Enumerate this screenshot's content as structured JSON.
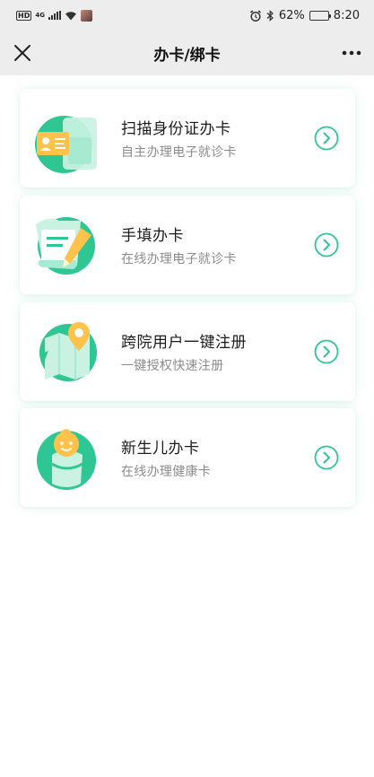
{
  "statusbar": {
    "hd": "HD",
    "network": "4G",
    "battery": "62%",
    "time": "8:20",
    "icons": [
      "alarm-icon",
      "bluetooth-icon",
      "wifi-icon",
      "signal-icon",
      "battery-icon"
    ]
  },
  "navbar": {
    "title": "办卡/绑卡",
    "close_icon": "close-icon",
    "more_icon": "more-icon"
  },
  "colors": {
    "accent": "#2ec793",
    "accent_light": "#c9f2e2",
    "orange": "#ffc24a",
    "background": "#ffffff",
    "bar": "#ededed"
  },
  "cards": [
    {
      "title": "扫描身份证办卡",
      "subtitle": "自主办理电子就诊卡",
      "icon": "id-card-scan-icon"
    },
    {
      "title": "手填办卡",
      "subtitle": "在线办理电子就诊卡",
      "icon": "form-pen-icon"
    },
    {
      "title": "跨院用户一键注册",
      "subtitle": "一键授权快速注册",
      "icon": "map-pin-icon"
    },
    {
      "title": "新生儿办卡",
      "subtitle": "在线办理健康卡",
      "icon": "newborn-icon"
    }
  ]
}
